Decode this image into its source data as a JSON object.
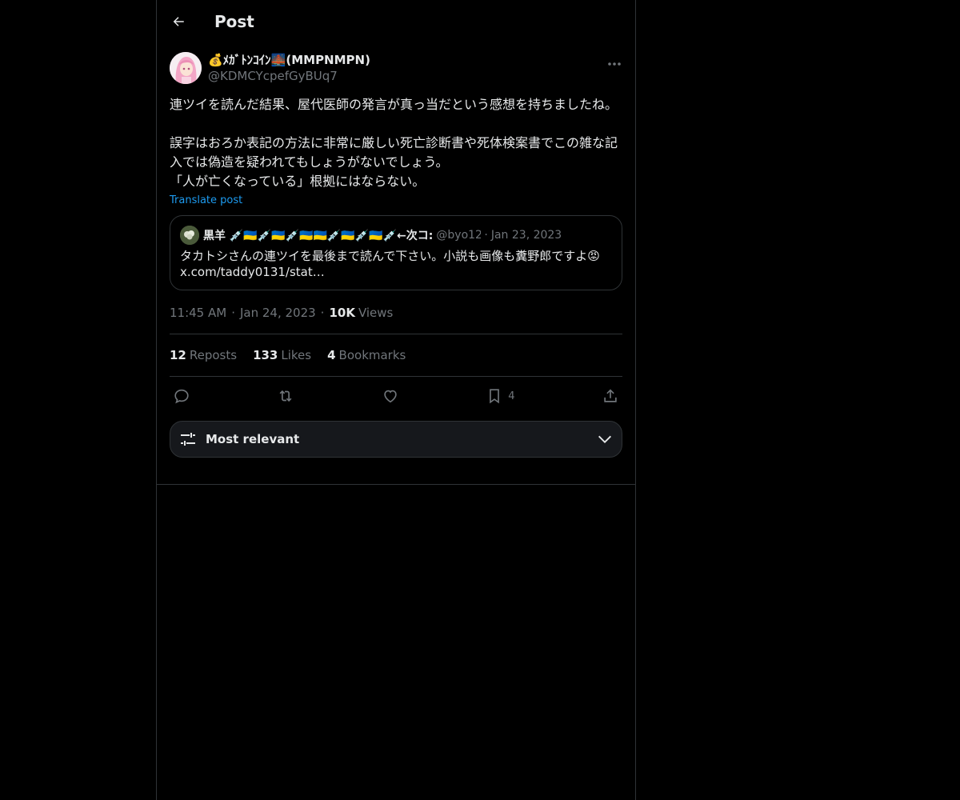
{
  "header": {
    "title": "Post",
    "back_icon": "arrow-left-icon"
  },
  "post": {
    "display_name": "💰ﾒｶﾞﾄﾝｺｲﾝ🌉(MMPNMPN)",
    "handle": "@KDMCYcpefGyBUq7",
    "text": "連ツイを読んだ結果、屋代医師の発言が真っ当だという感想を持ちましたね。\n\n誤字はおろか表記の方法に非常に厳しい死亡診断書や死体検案書でこの雑な記入では偽造を疑われてもしょうがないでしょう。\n「人が亡くなっている」根拠にはならない。",
    "translate_label": "Translate post",
    "time": "11:45 AM",
    "date": "Jan 24, 2023",
    "views_count": "10K",
    "views_label": "Views"
  },
  "quote": {
    "name": "黒羊 💉🇺🇦💉🇺🇦💉🇺🇦🇺🇦💉🇺🇦💉🇺🇦💉←次コ:",
    "handle": "@byo12",
    "date": "Jan 23, 2023",
    "text": "タカトシさんの連ツイを最後まで読んで下さい。小説も画像も糞野郎ですよ😡\nx.com/taddy0131/stat…"
  },
  "stats": {
    "reposts_count": "12",
    "reposts_label": "Reposts",
    "likes_count": "133",
    "likes_label": "Likes",
    "bookmarks_count": "4",
    "bookmarks_label": "Bookmarks"
  },
  "actions": {
    "bookmark_count": "4"
  },
  "sort": {
    "label": "Most relevant"
  },
  "colors": {
    "background": "#000000",
    "text": "#e7e9ea",
    "muted": "#71767b",
    "accent": "#1d9bf0",
    "border": "#2f3336"
  }
}
